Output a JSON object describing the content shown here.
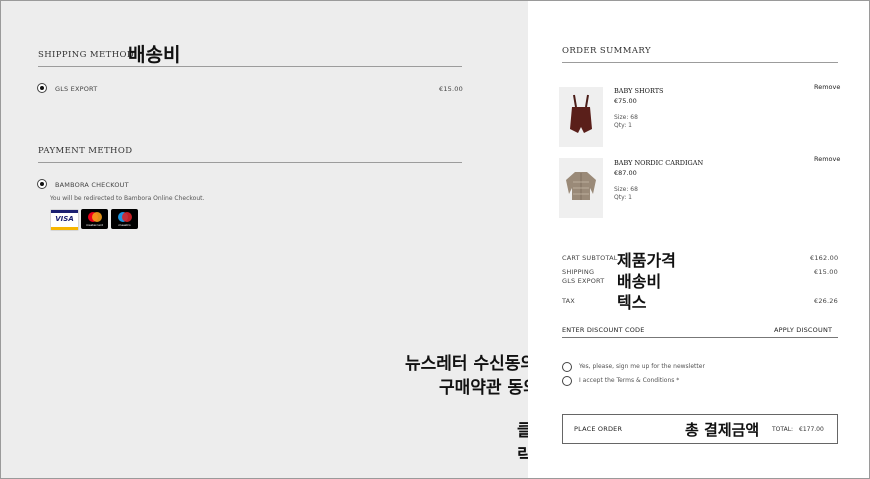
{
  "shipping": {
    "title": "SHIPPING METHOD",
    "annotation": "배송비",
    "option_label": "GLS EXPORT",
    "option_price": "€15.00"
  },
  "payment": {
    "title": "PAYMENT METHOD",
    "option_label": "BAMBORA CHECKOUT",
    "note": "You will be redirected to Bambora Online Checkout.",
    "cards": [
      "VISA",
      "mastercard",
      "maestro"
    ]
  },
  "summary": {
    "title": "ORDER SUMMARY",
    "items": [
      {
        "name": "BABY SHORTS",
        "price": "€75.00",
        "size": "Size: 68",
        "qty": "Qty: 1",
        "remove": "Remove"
      },
      {
        "name": "BABY NORDIC CARDIGAN",
        "price": "€87.00",
        "size": "Size: 68",
        "qty": "Qty: 1",
        "remove": "Remove"
      }
    ],
    "subtotal_label": "CART SUBTOTAL",
    "subtotal_annotation": "제품가격",
    "subtotal_value": "€162.00",
    "shipping_label_1": "SHIPPING",
    "shipping_label_2": "GLS EXPORT",
    "shipping_annotation": "배송비",
    "shipping_value": "€15.00",
    "tax_label": "TAX",
    "tax_annotation": "텍스",
    "tax_value": "€26.26",
    "discount_label": "ENTER DISCOUNT CODE",
    "discount_button": "APPLY DISCOUNT",
    "newsletter_annotation": "뉴스레터 수신동의",
    "newsletter_text": "Yes, please, sign me up for the newsletter",
    "terms_annotation": "구매약관 동의",
    "terms_text": "I accept the Terms & Conditions *",
    "click_annotation": "클릭",
    "place_order": "PLACE ORDER",
    "total_annotation": "총 결제금액",
    "total_label": "TOTAL:",
    "total_value": "€177.00"
  }
}
